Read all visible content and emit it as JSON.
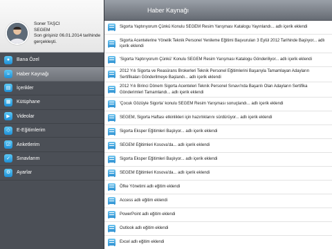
{
  "header": {
    "title": "Haber Kaynağı"
  },
  "profile": {
    "name": "Soner TAŞCI",
    "org": "SEGEM",
    "last_login": "Son girişiniz 06.01.2014 tarihinde gerçekleşti."
  },
  "menu": [
    {
      "label": "Bana Özel",
      "icon": "user-icon"
    },
    {
      "label": "Haber Kaynağı",
      "icon": "rss-icon",
      "active": true
    },
    {
      "label": "İçerikler",
      "icon": "file-icon"
    },
    {
      "label": "Kütüphane",
      "icon": "book-icon"
    },
    {
      "label": "Videolar",
      "icon": "video-icon"
    },
    {
      "label": "E-Eğitimlerim",
      "icon": "elearning-icon"
    },
    {
      "label": "Anketlerim",
      "icon": "survey-icon"
    },
    {
      "label": "Sınavlarım",
      "icon": "exam-icon"
    },
    {
      "label": "Ayarlar",
      "icon": "gear-icon"
    }
  ],
  "feed": [
    {
      "text": "Sigorta Yaptırıyorum Çünkü Konulu SEGEM Resim Yarışması Katalogu Yayınlandı... adlı içerik eklendi"
    },
    {
      "text": "Sigorta Acentelerine Yönelik Teknik Personel Yenileme Eğitimi Başvuruları 3 Eylül 2012 Tarihinde Başlıyor... adlı içerik eklendi"
    },
    {
      "text": "'Sigorta Yaptırıyorum Çünkü' Konulu SEGEM Resim Yarışması Katalogu Gönderiliyor... adlı içerik eklendi"
    },
    {
      "text": "2012 Yılı Sigorta ve Reasürans Brokerleri Teknik Personel Eğitimlerini Başarıyla Tamamlayan Adayların Sertifikaları Gönderilmeye Başlandı... adlı içerik eklendi"
    },
    {
      "text": "2012 Yılı Birinci Dönem Sigorta Acenteleri Teknik Personel Sınavı'nda Başarılı Olan Adayların Sertifika Gönderimleri Tamamlandı... adlı içerik eklendi"
    },
    {
      "text": "'Çocuk Gözüyle Sigorta' konulu SEGEM Resim Yarışması sonuçlandı... adlı içerik eklendi"
    },
    {
      "text": "SEGEM, Sigorta Haftası etkinlikleri için hazırlıklarını sürdürüyor... adlı içerik eklendi"
    },
    {
      "text": "Sigorta Eksper Eğitimleri Başlıyor... adlı içerik eklendi"
    },
    {
      "text": "SEGEM Eğitimleri Kosova'da... adlı içerik eklendi"
    },
    {
      "text": "Sigorta Eksper Eğitimleri Başlıyor... adlı içerik eklendi"
    },
    {
      "text": "SEGEM Eğitimleri Kosova'da... adlı içerik eklendi"
    },
    {
      "text": "Öfke Yönetimi adlı eğitim eklendi"
    },
    {
      "text": "Access adlı eğitim eklendi"
    },
    {
      "text": "PowerPoint adlı eğitim eklendi"
    },
    {
      "text": "Outlook adlı eğitim eklendi"
    },
    {
      "text": "Excel adlı eğitim eklendi"
    }
  ]
}
